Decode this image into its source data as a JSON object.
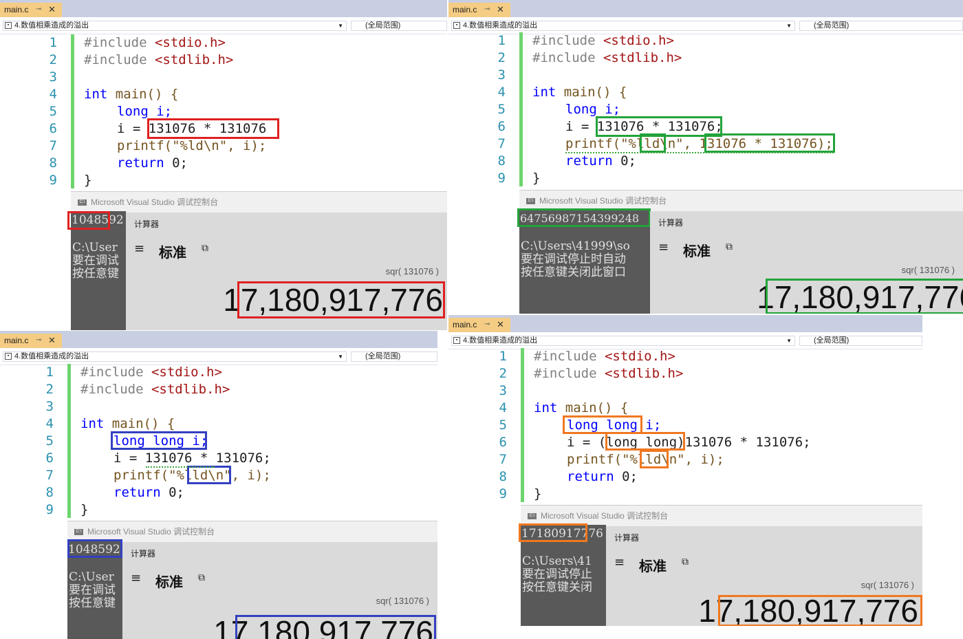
{
  "common": {
    "tab_label": "main.c",
    "tab_pin": "⊸",
    "tab_close": "✕",
    "scope_label": "4.数值相乘造成的溢出",
    "global_label": "(全局范围)",
    "console_title": "Microsoft Visual Studio 调试控制台",
    "calc_title": "计算器",
    "calc_mode": "标准",
    "calc_expr": "sqr( 131076 )",
    "calc_result": "17,180,917,776",
    "include1": "#include",
    "inc1": "<stdio.h>",
    "inc2": "<stdlib.h>",
    "kw_int": "int",
    "main_sig": "main() {",
    "kw_long": "long",
    "kw_return": "return",
    "ret_tail": "0;",
    "close_brace": "}",
    "printf": "printf",
    "line_numbers": [
      "1",
      "2",
      "3",
      "4",
      "5",
      "6",
      "7",
      "8",
      "9"
    ]
  },
  "panels": [
    {
      "id": "top-left",
      "output": "1048592",
      "console_lines": "C:\\User\n要在调试\n按任意键",
      "decl": "long i;",
      "assign": "i = 131076 * 131076",
      "printf_line": "printf(\"%ld\\n\", i);",
      "accent": "#e02020"
    },
    {
      "id": "top-right",
      "output": "64756987154399248",
      "console_lines": "C:\\Users\\41999\\so\n要在调试停止时自动\n按任意键关闭此窗口",
      "decl": "long i;",
      "assign": "i = 131076 * 131076;",
      "printf_line": "printf(\"%lld\\n\", 131076 * 131076);",
      "accent": "#22a33a"
    },
    {
      "id": "bottom-left",
      "output": "1048592",
      "console_lines": "C:\\User\n要在调试\n按任意键",
      "decl": "long long i;",
      "assign": "i = 131076 * 131076;",
      "printf_line": "printf(\"%lld\\n\", i);",
      "accent": "#3340c0"
    },
    {
      "id": "bottom-right",
      "output": "17180917776",
      "console_lines": "C:\\Users\\41\n要在调试停止\n按任意键关闭",
      "decl": "long long i;",
      "assign": "i = (long long)131076 * 131076;",
      "printf_line": "printf(\"%lld\\n\", i);",
      "accent": "#f07820"
    }
  ]
}
